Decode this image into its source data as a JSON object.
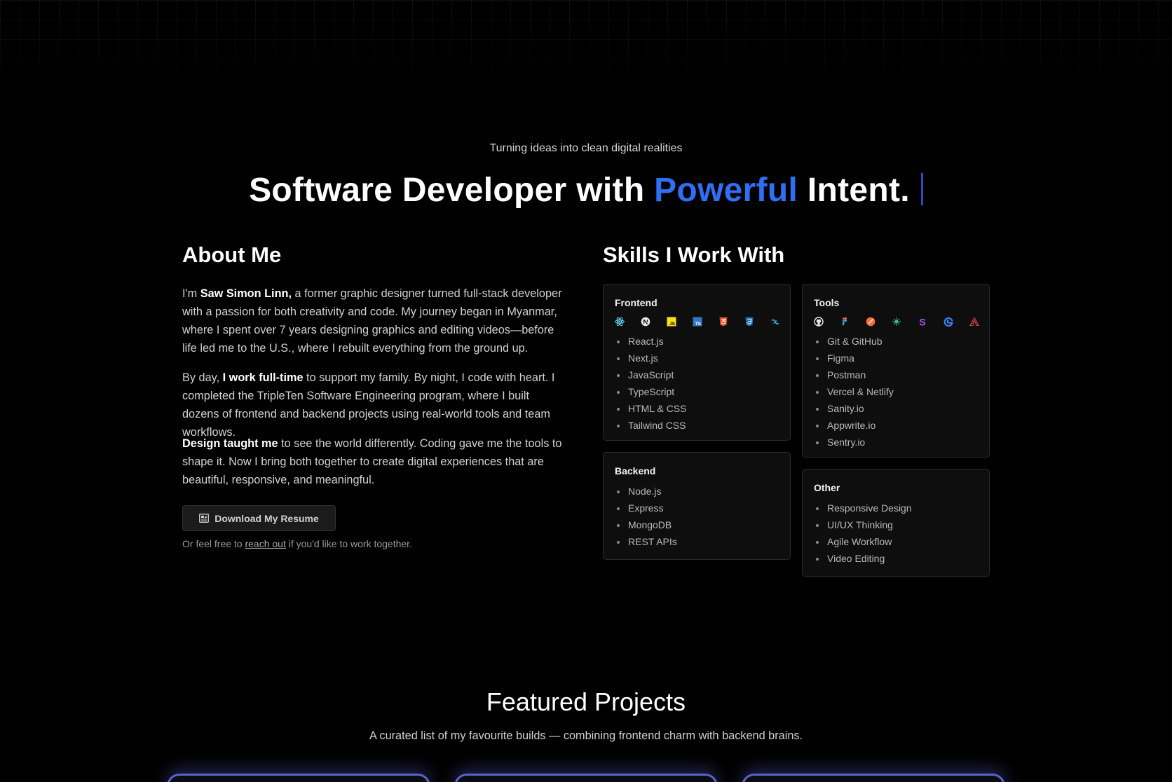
{
  "hero": {
    "subtitle": "Turning ideas into clean digital realities",
    "title_part1": "Software Developer with ",
    "title_accent": "Powerful",
    "title_part2": " Intent.",
    "accent_color": "#2f6ff3"
  },
  "about": {
    "heading": "About Me",
    "p1": {
      "pre": "I'm ",
      "bold": "Saw Simon Linn,",
      "post": " a former graphic designer turned full-stack developer with a passion for both creativity and code. My journey began in Myanmar, where I spent over 7 years designing graphics and editing videos—before life led me to the U.S., where I rebuilt everything from the ground up."
    },
    "p2": {
      "pre": "By day, ",
      "bold": "I work full-time",
      "post": " to support my family. By night, I code with heart. I completed the TripleTen Software Engineering program, where I built dozens of frontend and backend projects using real-world tools and team workflows."
    },
    "p3": {
      "bold": "Design taught me",
      "post": " to see the world differently. Coding gave me the tools to shape it. Now I bring both together to create digital experiences that are beautiful, responsive, and meaningful."
    },
    "resume_button": "Download My Resume",
    "reach": {
      "pre": "Or feel free to ",
      "link": "reach out",
      "post": " if you'd like to work together."
    }
  },
  "skills": {
    "heading": "Skills I Work With",
    "frontend": {
      "title": "Frontend",
      "icons": [
        "react-icon",
        "nextjs-icon",
        "javascript-icon",
        "typescript-icon",
        "html5-icon",
        "css3-icon",
        "tailwind-icon"
      ],
      "items": [
        "React.js",
        "Next.js",
        "JavaScript",
        "TypeScript",
        "HTML & CSS",
        "Tailwind CSS"
      ]
    },
    "tools": {
      "title": "Tools",
      "icons": [
        "github-icon",
        "figma-icon",
        "postman-icon",
        "vercel-netlify-icon",
        "sanity-icon",
        "appwrite-icon",
        "sentry-icon"
      ],
      "items": [
        "Git & GitHub",
        "Figma",
        "Postman",
        "Vercel & Netlify",
        "Sanity.io",
        "Appwrite.io",
        "Sentry.io"
      ]
    },
    "backend": {
      "title": "Backend",
      "items": [
        "Node.js",
        "Express",
        "MongoDB",
        "REST APIs"
      ]
    },
    "other": {
      "title": "Other",
      "items": [
        "Responsive Design",
        "UI/UX Thinking",
        "Agile Workflow",
        "Video Editing"
      ]
    }
  },
  "featured": {
    "title": "Featured Projects",
    "subtitle": "A curated list of my favourite builds — combining frontend charm with backend brains."
  }
}
